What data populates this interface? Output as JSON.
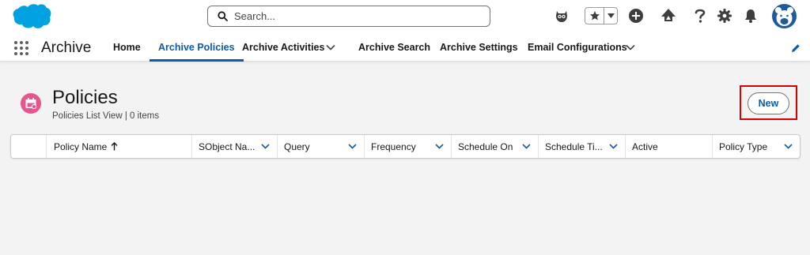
{
  "header": {
    "search_placeholder": "Search...",
    "icons": [
      "salesforce-cloud-logo",
      "astro-mascot-icon",
      "favorites-star-icon",
      "favorites-dropdown-icon",
      "global-add-icon",
      "trailhead-icon",
      "help-icon",
      "setup-gear-icon",
      "notifications-bell-icon",
      "avatar"
    ]
  },
  "nav": {
    "app_name": "Archive",
    "items": [
      {
        "label": "Home"
      },
      {
        "label": "Archive Policies",
        "active": true
      },
      {
        "label": "Archive Activities",
        "has_dropdown": true
      },
      {
        "label": "Archive Search"
      },
      {
        "label": "Archive Settings"
      },
      {
        "label": "Email Configurations",
        "has_dropdown": true
      }
    ]
  },
  "page": {
    "title": "Policies",
    "subtitle": "Policies List View | 0 items",
    "new_button": "New"
  },
  "table": {
    "columns": [
      {
        "label": "Policy Name",
        "sorted": "asc"
      },
      {
        "label": "SObject Na..."
      },
      {
        "label": "Query"
      },
      {
        "label": "Frequency"
      },
      {
        "label": "Schedule On"
      },
      {
        "label": "Schedule Ti..."
      },
      {
        "label": "Active"
      },
      {
        "label": "Policy Type"
      }
    ],
    "rows": []
  },
  "colors": {
    "brand_blue": "#0b5cab",
    "cloud_blue": "#00a1e0",
    "object_icon_pink": "#e8558c",
    "highlight_red": "#d50000"
  }
}
